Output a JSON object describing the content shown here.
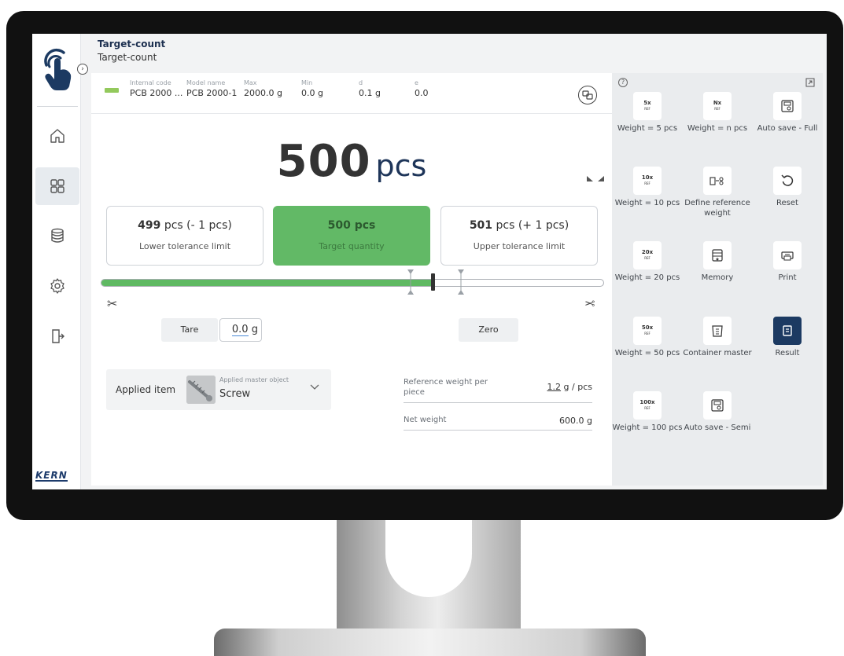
{
  "header": {
    "title": "Target-count",
    "subtitle": "Target-count"
  },
  "nav": {
    "logo_text": "KERN"
  },
  "info": [
    {
      "label": "Internal code",
      "value": "PCB 2000 ..."
    },
    {
      "label": "Model name",
      "value": "PCB 2000-1"
    },
    {
      "label": "Max",
      "value": "2000.0 g"
    },
    {
      "label": "Min",
      "value": "0.0 g"
    },
    {
      "label": "d",
      "value": "0.1 g"
    },
    {
      "label": "e",
      "value": "0.0"
    }
  ],
  "readout": {
    "value": "500",
    "unit": "pcs"
  },
  "tolerance": {
    "lower": {
      "count": "499",
      "rest": "pcs (- 1 pcs)",
      "label": "Lower tolerance limit"
    },
    "target": {
      "text": "500 pcs",
      "label": "Target quantity"
    },
    "upper": {
      "count": "501",
      "rest": "pcs (+ 1 pcs)",
      "label": "Upper tolerance limit"
    }
  },
  "progress": {
    "fill_fraction": 0.66
  },
  "actions": {
    "tare_label": "Tare",
    "tare_value": "0.0",
    "tare_unit": "g",
    "zero_label": "Zero"
  },
  "applied": {
    "label": "Applied item",
    "sub_label": "Applied master object",
    "value": "Screw"
  },
  "reference": [
    {
      "label": "Reference weight per piece",
      "value_num": "1.2",
      "value_unit": " g / pcs"
    },
    {
      "label": "Net weight",
      "value_num": "600.0 g",
      "value_unit": ""
    }
  ],
  "quick": [
    {
      "id": "weight-5",
      "label": "Weight = 5 pcs",
      "icon": "5x-ref-icon",
      "big": "5x"
    },
    {
      "id": "weight-n",
      "label": "Weight = n pcs",
      "icon": "nx-ref-icon",
      "big": "Nx"
    },
    {
      "id": "auto-save-full",
      "label": "Auto save - Full",
      "icon": "save-device-icon",
      "big": ""
    },
    {
      "id": "weight-10",
      "label": "Weight = 10 pcs",
      "icon": "10x-ref-icon",
      "big": "10x"
    },
    {
      "id": "define-ref",
      "label": "Define reference weight",
      "icon": "define-reference-icon",
      "big": ""
    },
    {
      "id": "reset",
      "label": "Reset",
      "icon": "reset-icon",
      "big": ""
    },
    {
      "id": "weight-20",
      "label": "Weight = 20 pcs",
      "icon": "20x-ref-icon",
      "big": "20x"
    },
    {
      "id": "memory",
      "label": "Memory",
      "icon": "memory-icon",
      "big": ""
    },
    {
      "id": "print",
      "label": "Print",
      "icon": "print-icon",
      "big": ""
    },
    {
      "id": "weight-50",
      "label": "Weight = 50 pcs",
      "icon": "50x-ref-icon",
      "big": "50x"
    },
    {
      "id": "container-master",
      "label": "Container master",
      "icon": "container-icon",
      "big": ""
    },
    {
      "id": "result",
      "label": "Result",
      "icon": "result-icon",
      "big": ""
    },
    {
      "id": "weight-100",
      "label": "Weight = 100 pcs",
      "icon": "100x-ref-icon",
      "big": "100x"
    },
    {
      "id": "auto-save-semi",
      "label": "Auto save - Semi",
      "icon": "save-device-icon",
      "big": ""
    }
  ],
  "ref_small": "REF",
  "colors": {
    "accent_green": "#62b966",
    "brand_navy": "#1c3a62",
    "nav_active": "#e7ebef"
  }
}
